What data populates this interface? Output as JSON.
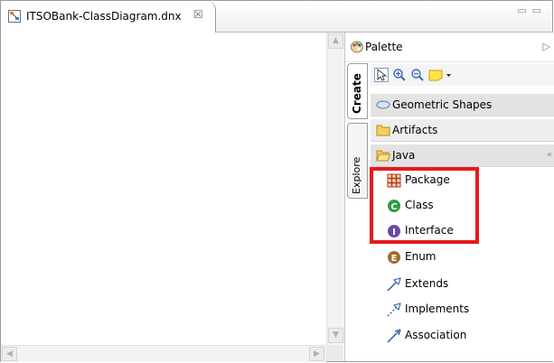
{
  "editor_tab": {
    "label": "ITSOBank-ClassDiagram.dnx",
    "close_glyph": "☒"
  },
  "window_controls": {
    "minimize": "▭",
    "maximize": "▭"
  },
  "palette": {
    "title": "Palette",
    "collapse_glyph": "▷",
    "tabs": {
      "create": "Create",
      "explore": "Explore"
    },
    "tools": [
      "select-tool-icon",
      "zoom-in-icon",
      "zoom-out-icon",
      "note-icon"
    ],
    "drawers": [
      {
        "label": "Geometric Shapes",
        "icon": "ellipse-icon"
      },
      {
        "label": "Artifacts",
        "icon": "folder-icon"
      },
      {
        "label": "Java",
        "icon": "folder-open-icon",
        "collapse_glyph": "«"
      }
    ],
    "java_items": [
      {
        "label": "Package",
        "icon": "package-icon"
      },
      {
        "label": "Class",
        "icon": "class-icon",
        "color": "#2e9b45"
      },
      {
        "label": "Interface",
        "icon": "interface-icon",
        "color": "#6a4aa5"
      },
      {
        "label": "Enum",
        "icon": "enum-icon",
        "color": "#a06a2b"
      },
      {
        "label": "Extends",
        "icon": "extends-arrow-icon"
      },
      {
        "label": "Implements",
        "icon": "implements-arrow-icon"
      },
      {
        "label": "Association",
        "icon": "association-arrow-icon"
      }
    ]
  },
  "highlight_color": "#e51a1a",
  "scroll_glyphs": {
    "up": "▲",
    "down": "▼",
    "left": "◀",
    "right": "▶"
  }
}
